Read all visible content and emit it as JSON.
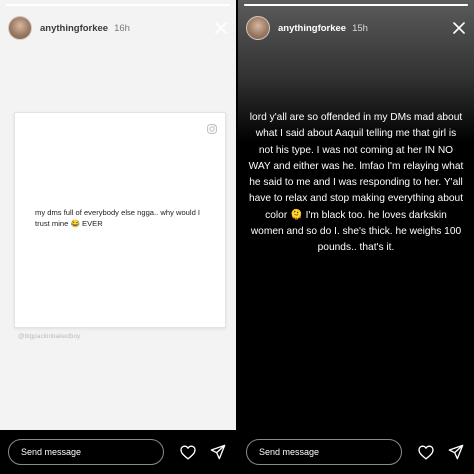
{
  "left_story": {
    "username": "anythingforkee",
    "time": "16h",
    "progress": 1.0,
    "post_text": "my dms full of everybody else ngga.. why would I trust mine 😂 EVER",
    "watermark": "@bigpackinbakedboy",
    "message_placeholder": "Send message",
    "icons": [
      "avatar",
      "close-icon",
      "instagram-icon",
      "heart-icon",
      "send-icon"
    ]
  },
  "right_story": {
    "username": "anythingforkee",
    "time": "15h",
    "progress": 1.0,
    "story_text": "lord y'all are so offended in my DMs mad about what I said about Aaquil telling me that girl is not his type. I was not coming at her IN NO WAY and either was he. lmfao I'm relaying what he said to me and I was responding to her. Y'all have to relax and stop making everything about color 🫠 I'm black too. he loves darkskin women and so do I. she's thick. he weighs 100 pounds.. that's it.",
    "message_placeholder": "Send message",
    "icons": [
      "avatar",
      "close-icon",
      "heart-icon",
      "send-icon"
    ]
  },
  "colors": {
    "left_background": "#f3f3f3",
    "right_background_top": "#5b5b5b",
    "right_background_bottom": "#000000",
    "text_light": "#ffffff",
    "text_dark": "#222222"
  }
}
